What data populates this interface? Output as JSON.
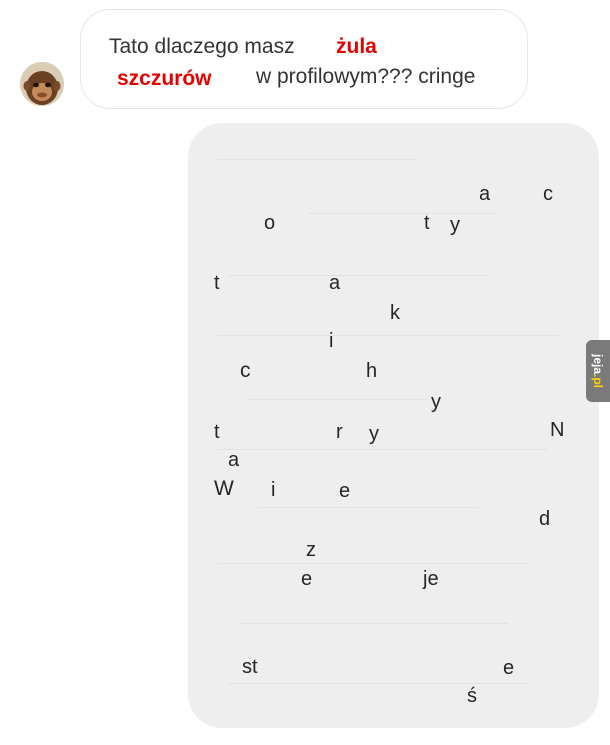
{
  "incoming_message": {
    "line1_text": "Tato dlaczego masz",
    "line1_highlight": "żula",
    "line2_highlight": "szczurów",
    "line2_text": "w profilowym??? cringe"
  },
  "outgoing_message": {
    "letters": [
      "a",
      "c",
      "o",
      "t",
      "y",
      "t",
      "a",
      "k",
      "i",
      "c",
      "h",
      "y",
      "t",
      "r",
      "y",
      "N",
      "a",
      "W",
      "i",
      "e",
      "d",
      "z",
      "e",
      "je",
      "st",
      "e",
      "ś"
    ]
  },
  "watermark": {
    "text_main": "jeja",
    "text_accent": "pl",
    "separator": "."
  },
  "colors": {
    "highlight": "#e30000",
    "bubble_gray": "#eeeeee",
    "watermark_bg": "#7a7a7a",
    "watermark_accent": "#ffd400"
  },
  "icons": {
    "avatar": "monkey-face-avatar"
  }
}
